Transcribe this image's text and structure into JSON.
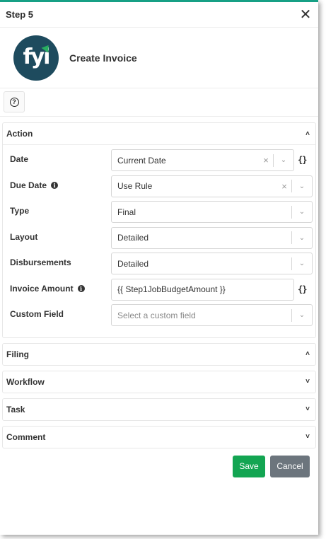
{
  "header": {
    "title": "Step 5",
    "close_icon": "close-icon"
  },
  "app": {
    "name": "Create Invoice",
    "logo_text": "fyi",
    "logo_color": "#1e4b5e",
    "accent": "#27ae60"
  },
  "help": {
    "icon": "question-circle-icon",
    "glyph": "?"
  },
  "sections": {
    "action": {
      "title": "Action",
      "expanded": true
    },
    "filing": {
      "title": "Filing",
      "expanded": true
    },
    "workflow": {
      "title": "Workflow",
      "expanded": false
    },
    "task": {
      "title": "Task",
      "expanded": false
    },
    "comment": {
      "title": "Comment",
      "expanded": false
    }
  },
  "fields": {
    "date": {
      "label": "Date",
      "value": "Current Date"
    },
    "due_date": {
      "label": "Due Date",
      "value": "Use Rule"
    },
    "type": {
      "label": "Type",
      "value": "Final"
    },
    "layout": {
      "label": "Layout",
      "value": "Detailed"
    },
    "disbursements": {
      "label": "Disbursements",
      "value": "Detailed"
    },
    "invoice_amount": {
      "label": "Invoice Amount",
      "value": "{{ Step1JobBudgetAmount }}"
    },
    "custom_field": {
      "label": "Custom Field",
      "placeholder": "Select a custom field"
    }
  },
  "glyphs": {
    "clear": "×",
    "dropdown": "⌄",
    "braces": "{}",
    "info": "i",
    "collapse": "˄",
    "expand": "˅",
    "close": "✕"
  },
  "buttons": {
    "save": "Save",
    "cancel": "Cancel"
  },
  "colors": {
    "top_border": "#16a085",
    "save_bg": "#13a552",
    "cancel_bg": "#6c757d"
  }
}
